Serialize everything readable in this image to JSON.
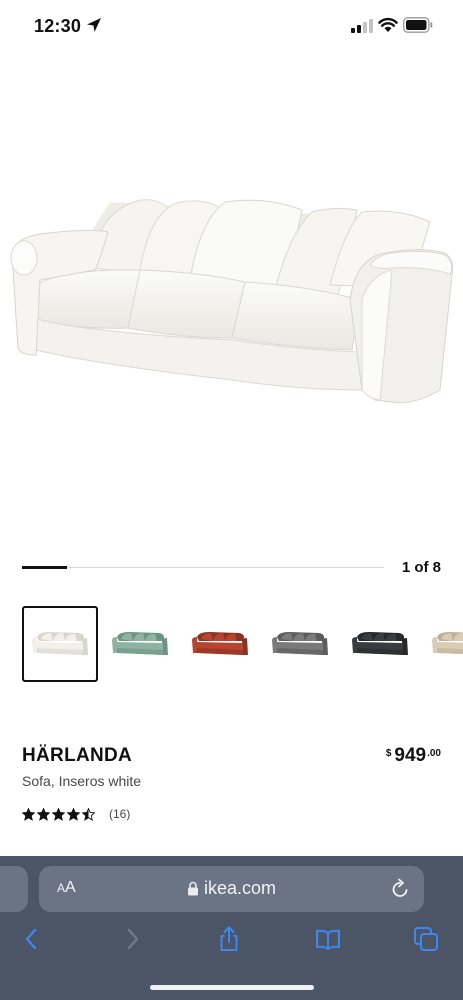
{
  "status_bar": {
    "time": "12:30",
    "icons": [
      "location-arrow-icon",
      "signal-icon",
      "wifi-icon",
      "battery-icon"
    ]
  },
  "product": {
    "hero_image": "sofa-white-image",
    "carousel": {
      "page_indicator": "1 of 8",
      "current_page": 1,
      "total_pages": 8
    },
    "thumbnails": [
      {
        "name": "white",
        "color": "#f1f0ea",
        "shade": "#d8d6cd",
        "selected": true
      },
      {
        "name": "green",
        "color": "#8fb3a2",
        "shade": "#6e9382",
        "selected": false
      },
      {
        "name": "red",
        "color": "#b5452f",
        "shade": "#8b3222",
        "selected": false
      },
      {
        "name": "gray",
        "color": "#7a7a7a",
        "shade": "#5c5c5c",
        "selected": false
      },
      {
        "name": "dark-gray",
        "color": "#3a3c40",
        "shade": "#26282b",
        "selected": false
      },
      {
        "name": "beige",
        "color": "#d9ccb6",
        "shade": "#bfb097",
        "selected": false
      }
    ],
    "name": "HÄRLANDA",
    "description": "Sofa, Inseros white",
    "price": {
      "currency": "$",
      "main": "949",
      "cents": ".00"
    },
    "rating": {
      "stars": 4.5,
      "review_count": "(16)"
    }
  },
  "browser": {
    "aa_label_small": "A",
    "aa_label_large": "A",
    "url": "ikea.com",
    "toolbar": [
      "back-icon",
      "forward-icon",
      "share-icon",
      "bookmarks-icon",
      "tabs-icon"
    ],
    "colors": {
      "bar": "#4b5566",
      "field": "#6b7484",
      "accent": "#3d87f0"
    }
  }
}
